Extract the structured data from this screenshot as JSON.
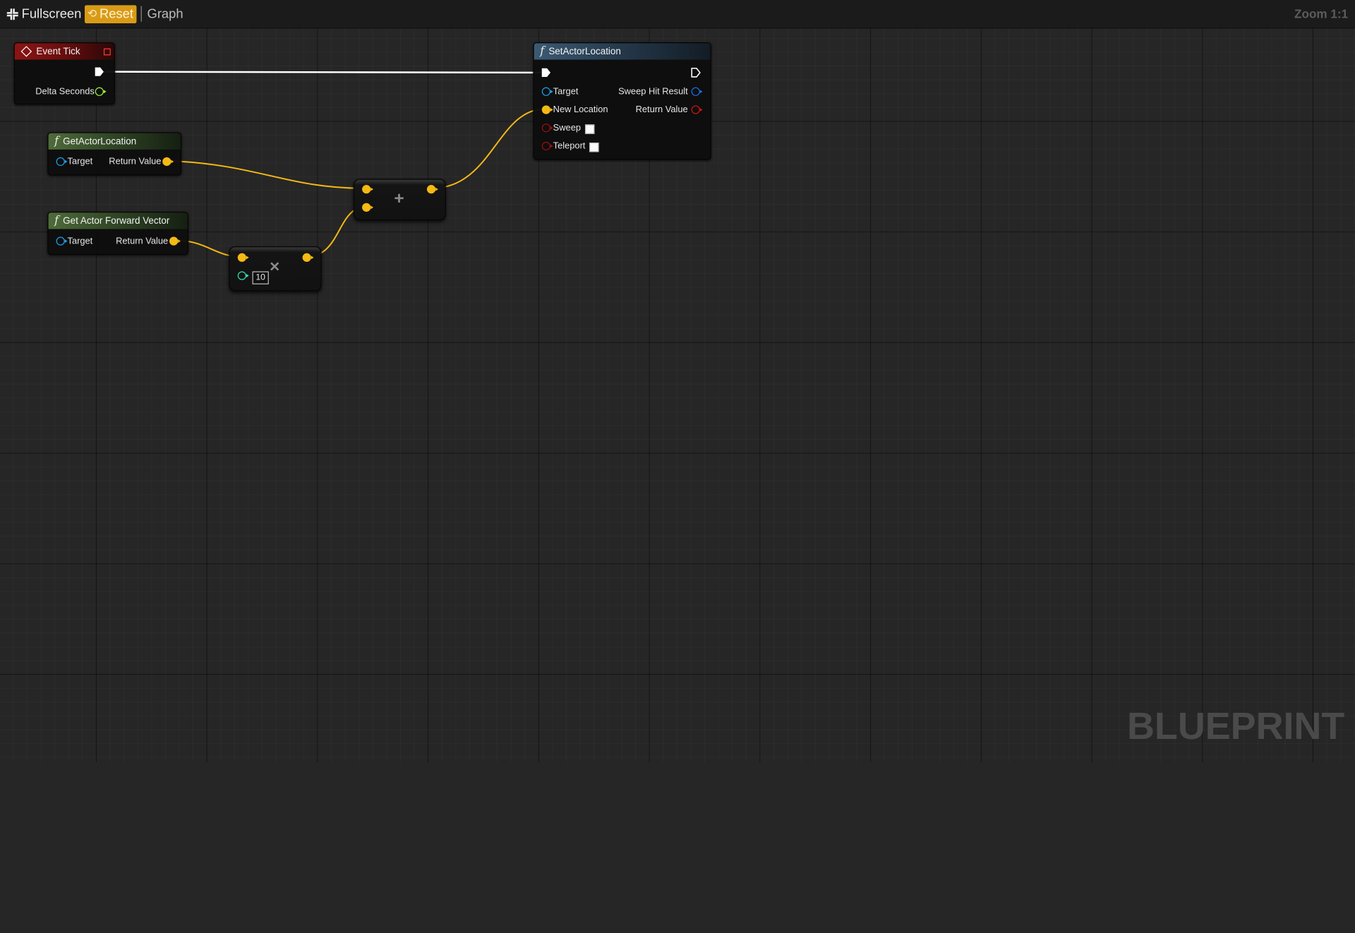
{
  "toolbar": {
    "fullscreen_label": "Fullscreen",
    "reset_label": "Reset",
    "graph_label": "Graph",
    "zoom_label": "Zoom 1:1"
  },
  "watermark": "BLUEPRINT",
  "nodes": {
    "event_tick": {
      "title": "Event Tick",
      "pins": {
        "delta_seconds": "Delta Seconds"
      }
    },
    "set_actor_location": {
      "title": "SetActorLocation",
      "pins": {
        "target": "Target",
        "new_location": "New Location",
        "sweep": "Sweep",
        "teleport": "Teleport",
        "sweep_hit_result": "Sweep Hit Result",
        "return_value": "Return Value"
      },
      "sweep_checked": false,
      "teleport_checked": false
    },
    "get_actor_location": {
      "title": "GetActorLocation",
      "pins": {
        "target": "Target",
        "return_value": "Return Value"
      }
    },
    "get_actor_forward_vector": {
      "title": "Get Actor Forward Vector",
      "pins": {
        "target": "Target",
        "return_value": "Return Value"
      }
    },
    "add_node": {
      "symbol": "+"
    },
    "multiply_node": {
      "symbol": "×",
      "scalar_value": "10"
    }
  },
  "colors": {
    "vector_wire": "#f5b914",
    "exec_wire": "#ffffff",
    "event_header": "#8c1414",
    "function_header": "#3c5a73",
    "pure_header": "#4f6b3a",
    "object_pin": "#1aa0ee",
    "float_pin": "#9af53c",
    "int_pin": "#2ee0b0",
    "bool_pin": "#a00d0d",
    "reset_button": "#d99b16"
  },
  "icons": {
    "fullscreen": "fullscreen-icon",
    "reset": "reset-icon",
    "event": "event-diamond-icon",
    "function": "function-f-icon",
    "exec": "exec-arrow-icon"
  }
}
